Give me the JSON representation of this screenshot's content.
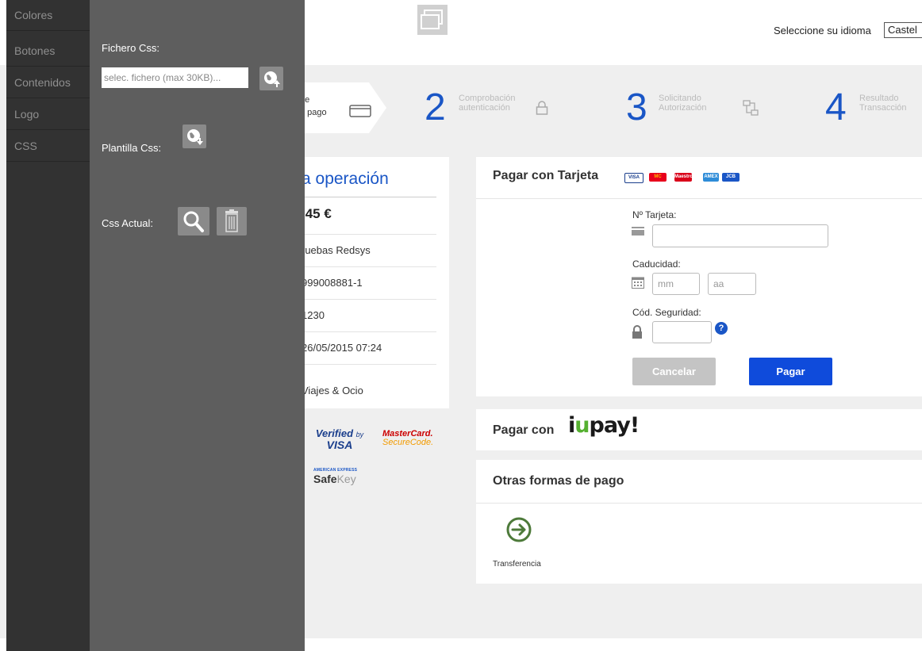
{
  "menu": {
    "items": [
      {
        "label": "Colores"
      },
      {
        "label": "Botones"
      },
      {
        "label": "Contenidos"
      },
      {
        "label": "Logo"
      },
      {
        "label": "CSS"
      }
    ]
  },
  "editor": {
    "fichero_label": "Fichero Css:",
    "fichero_placeholder": "selec. fichero (max 30KB)...",
    "plantilla_label": "Plantilla Css:",
    "actual_label": "Css Actual:"
  },
  "header": {
    "language_label": "Seleccione su idioma",
    "language_value": "Castel"
  },
  "steps": [
    {
      "number": "",
      "line1": "ne",
      "line2": "e pago"
    },
    {
      "number": "2",
      "line1": "Comprobación",
      "line2": "autenticación"
    },
    {
      "number": "3",
      "line1": "Solicitando",
      "line2": "Autorización"
    },
    {
      "number": "4",
      "line1": "Resultado",
      "line2": "Transacción"
    }
  ],
  "summary": {
    "title": "a operación",
    "amount": ",45 €",
    "rows": [
      "ruebas Redsys",
      "999008881-1",
      "1230",
      "26/05/2015   07:24",
      "Viajes & Ocio"
    ]
  },
  "security_logos": {
    "vbv_top": "Verified",
    "vbv_by": "by",
    "vbv_bottom": "VISA",
    "mc_top": "MasterCard.",
    "mc_bottom": "SecureCode.",
    "amex": "AMERICAN EXPRESS",
    "safekey_a": "Safe",
    "safekey_b": "Key"
  },
  "card_panel": {
    "title": "Pagar con Tarjeta",
    "brands": [
      "VISA",
      "MC",
      "Maestro",
      "AMEX",
      "JCB"
    ],
    "card_label": "Nº Tarjeta:",
    "exp_label": "Caducidad:",
    "mm_placeholder": "mm",
    "aa_placeholder": "aa",
    "cvv_label": "Cód. Seguridad:",
    "help": "?",
    "cancel": "Cancelar",
    "pay": "Pagar"
  },
  "iupay": {
    "label": "Pagar con",
    "logo_a": "i",
    "logo_b": "u",
    "logo_c": "pay!"
  },
  "other": {
    "title": "Otras formas de pago",
    "transfer": "Transferencia"
  },
  "colors": {
    "accent_blue": "#1a56c6",
    "pay_button": "#0f4bdb",
    "menu_bg": "#323232",
    "editor_bg": "#5e5e5e",
    "iupay_green": "#55b030"
  }
}
